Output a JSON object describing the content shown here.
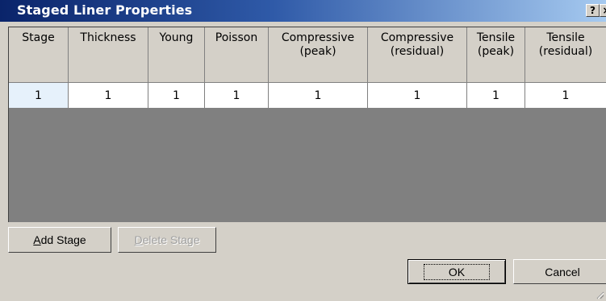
{
  "window": {
    "title": "Staged Liner Properties",
    "help_label": "?",
    "close_label": "×"
  },
  "grid": {
    "columns": [
      {
        "label": "Stage"
      },
      {
        "label": "Thickness"
      },
      {
        "label": "Young"
      },
      {
        "label": "Poisson"
      },
      {
        "label": "Compressive\n(peak)"
      },
      {
        "label": "Compressive\n(residual)"
      },
      {
        "label": "Tensile\n(peak)"
      },
      {
        "label": "Tensile\n(residual)"
      }
    ],
    "rows": [
      [
        "1",
        "1",
        "1",
        "1",
        "1",
        "1",
        "1",
        "1"
      ]
    ]
  },
  "buttons": {
    "add_stage": {
      "pre": "",
      "key": "A",
      "post": "dd Stage"
    },
    "delete_stage": {
      "pre": "",
      "key": "D",
      "post": "elete Stage"
    },
    "ok": "OK",
    "cancel": "Cancel"
  }
}
